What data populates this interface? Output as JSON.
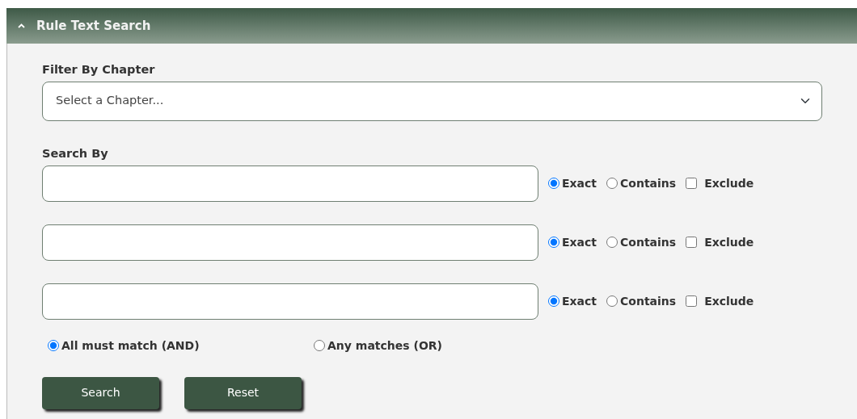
{
  "panel": {
    "title": "Rule Text Search",
    "expanded": true
  },
  "chapter_filter": {
    "label": "Filter By Chapter",
    "placeholder": "Select a Chapter..."
  },
  "search_by": {
    "label": "Search By",
    "rows": [
      {
        "modes": [
          {
            "label": "Exact",
            "selected": true
          },
          {
            "label": "Contains",
            "selected": false
          }
        ],
        "exclude": {
          "label": "Exclude",
          "checked": false
        }
      },
      {
        "modes": [
          {
            "label": "Exact",
            "selected": true
          },
          {
            "label": "Contains",
            "selected": false
          }
        ],
        "exclude": {
          "label": "Exclude",
          "checked": false
        }
      },
      {
        "modes": [
          {
            "label": "Exact",
            "selected": true
          },
          {
            "label": "Contains",
            "selected": false
          }
        ],
        "exclude": {
          "label": "Exclude",
          "checked": false
        }
      }
    ]
  },
  "match_mode": [
    {
      "label": "All must match (AND)",
      "selected": true
    },
    {
      "label": "Any matches (OR)",
      "selected": false
    }
  ],
  "buttons": [
    "Search",
    "Reset"
  ]
}
